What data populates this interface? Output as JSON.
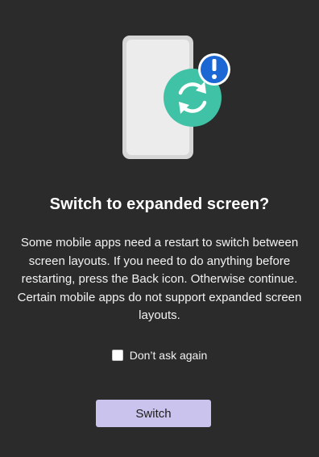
{
  "dialog": {
    "title": "Switch to expanded screen?",
    "message": "Some mobile apps need a restart to switch between screen layouts. If you need to do anything before restarting, press the Back icon. Otherwise continue. Certain mobile apps do not support expanded screen layouts.",
    "checkbox": {
      "label": "Don’t ask again",
      "checked": false
    },
    "primary_button_label": "Switch"
  },
  "illustration": {
    "icons": [
      "phone-icon",
      "refresh-icon",
      "alert-icon"
    ]
  },
  "colors": {
    "background": "#2b2b2b",
    "phone_frame": "#d9d9d9",
    "refresh_badge": "#3cc0a3",
    "alert_badge": "#1b66d2",
    "button": "#c9c3ee"
  }
}
